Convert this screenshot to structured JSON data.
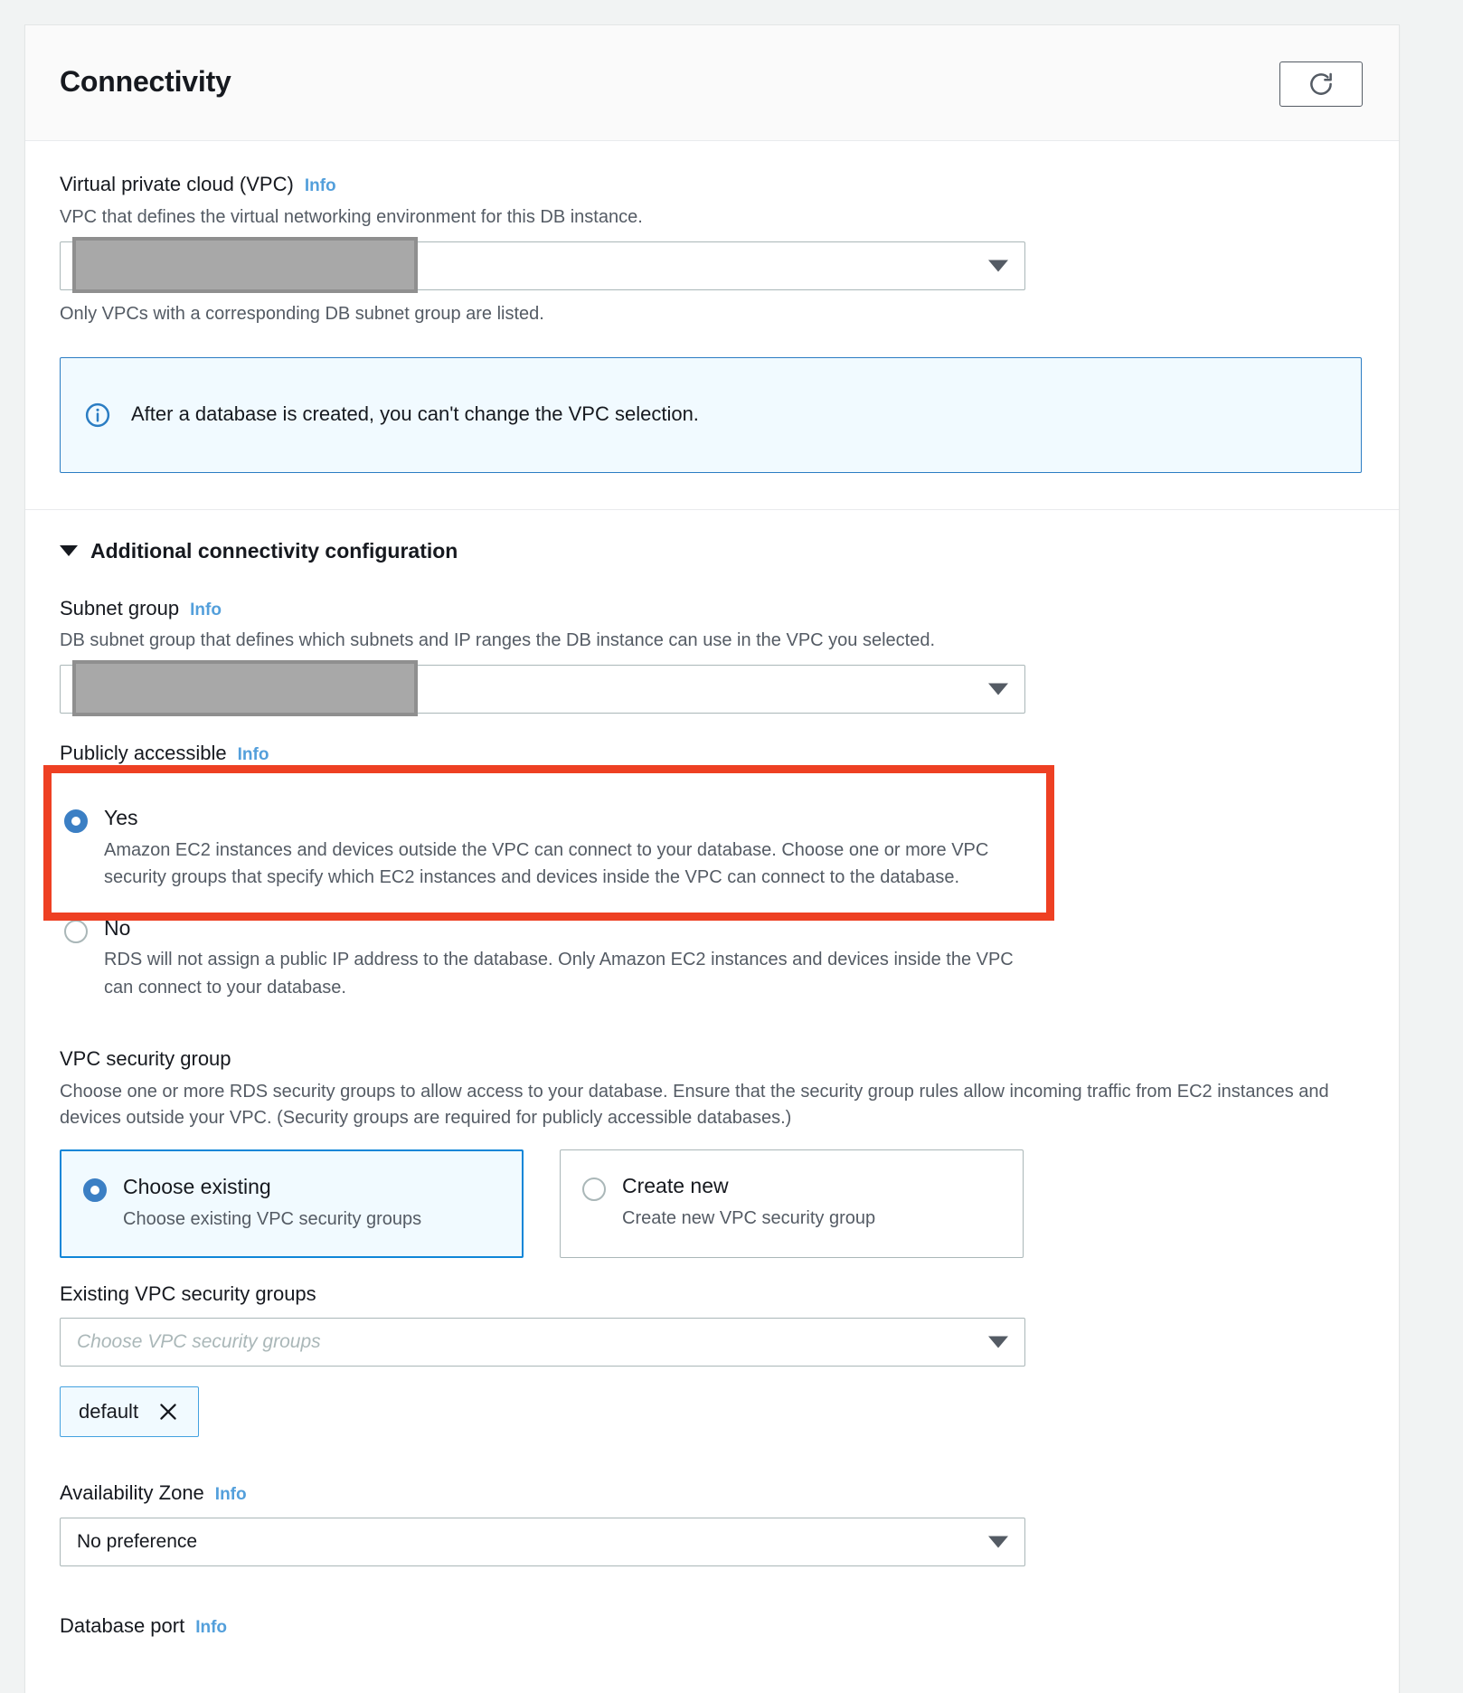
{
  "header": {
    "title": "Connectivity",
    "refresh_icon": "refresh-icon"
  },
  "vpc": {
    "label": "Virtual private cloud (VPC)",
    "info": "Info",
    "description": "VPC that defines the virtual networking environment for this DB instance.",
    "select_value": "",
    "redacted": true,
    "hint": "Only VPCs with a corresponding DB subnet group are listed.",
    "alert": {
      "icon": "info-circle-icon",
      "text": "After a database is created, you can't change the VPC selection."
    }
  },
  "additional": {
    "heading": "Additional connectivity configuration",
    "expanded": true,
    "subnet_group": {
      "label": "Subnet group",
      "info": "Info",
      "description": "DB subnet group that defines which subnets and IP ranges the DB instance can use in the VPC you selected.",
      "select_value": "",
      "redacted": true
    },
    "publicly_accessible": {
      "label": "Publicly accessible",
      "info": "Info",
      "highlighted": true,
      "options": [
        {
          "label": "Yes",
          "selected": true,
          "description": "Amazon EC2 instances and devices outside the VPC can connect to your database. Choose one or more VPC security groups that specify which EC2 instances and devices inside the VPC can connect to the database."
        },
        {
          "label": "No",
          "selected": false,
          "description": "RDS will not assign a public IP address to the database. Only Amazon EC2 instances and devices inside the VPC can connect to your database."
        }
      ]
    },
    "vpc_security_group": {
      "label": "VPC security group",
      "description": "Choose one or more RDS security groups to allow access to your database. Ensure that the security group rules allow incoming traffic from EC2 instances and devices outside your VPC. (Security groups are required for publicly accessible databases.)",
      "tiles": [
        {
          "title": "Choose existing",
          "subtitle": "Choose existing VPC security groups",
          "selected": true
        },
        {
          "title": "Create new",
          "subtitle": "Create new VPC security group",
          "selected": false
        }
      ]
    },
    "existing_sg": {
      "label": "Existing VPC security groups",
      "placeholder": "Choose VPC security groups",
      "value": "",
      "tokens": [
        {
          "label": "default",
          "remove_icon": "close-x-icon"
        }
      ]
    },
    "availability_zone": {
      "label": "Availability Zone",
      "info": "Info",
      "value": "No preference"
    },
    "database_port": {
      "label": "Database port",
      "info": "Info"
    }
  },
  "colors": {
    "highlight_red": "#ee4023",
    "accent_blue": "#0f86d8",
    "info_link": "#539fdb",
    "radio_selected": "#3b7fc4"
  }
}
